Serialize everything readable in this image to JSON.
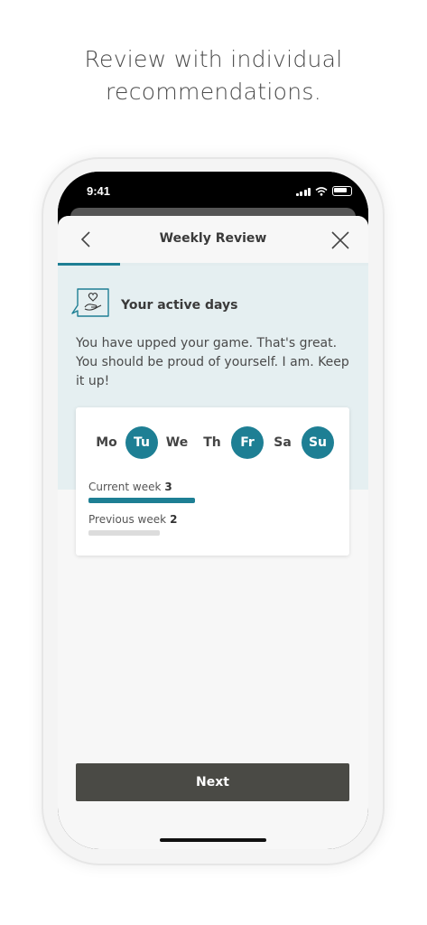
{
  "headline": {
    "line1": "Review with individual",
    "line2": "recommendations."
  },
  "status_bar": {
    "time": "9:41"
  },
  "nav": {
    "title": "Weekly Review",
    "back_icon": "chevron-left-icon",
    "close_icon": "close-icon"
  },
  "review_progress": 0.2,
  "section": {
    "title": "Your active days",
    "icon": "heart-hand-chat-icon",
    "message": "You have upped your game. That's great. You should be proud of yourself. I am. Keep it up!"
  },
  "days": [
    {
      "label": "Mo",
      "active": false
    },
    {
      "label": "Tu",
      "active": true
    },
    {
      "label": "We",
      "active": false
    },
    {
      "label": "Th",
      "active": false
    },
    {
      "label": "Fr",
      "active": true
    },
    {
      "label": "Sa",
      "active": false
    },
    {
      "label": "Su",
      "active": true
    }
  ],
  "weeks": {
    "current_label": "Current week",
    "current_value": "3",
    "previous_label": "Previous week",
    "previous_value": "2"
  },
  "next_button": "Next",
  "colors": {
    "accent": "#1e7f94",
    "panel": "#e5eff1",
    "button": "#4a4a45"
  }
}
